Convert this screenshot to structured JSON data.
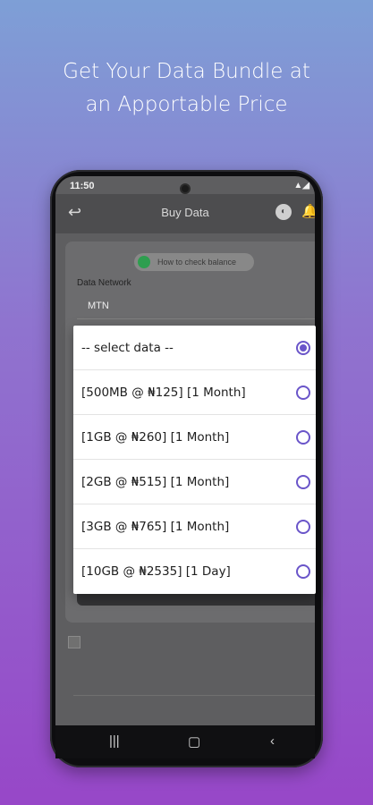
{
  "headline": {
    "line1": "Get Your Data Bundle at",
    "line2": "an Apportable Price"
  },
  "status_bar": {
    "time": "11:50"
  },
  "app_bar": {
    "title": "Buy Data",
    "back_icon": "back-arrow-icon",
    "wallet_icon": "wallet-icon",
    "bell_icon": "bell-icon"
  },
  "balance_chip": {
    "label": "How to check balance"
  },
  "network": {
    "label": "Data Network",
    "value": "MTN"
  },
  "data_options": [
    {
      "label": "-- select data --",
      "selected": true
    },
    {
      "label": "[500MB @ ₦125] [1 Month]",
      "selected": false
    },
    {
      "label": "[1GB @ ₦260] [1 Month]",
      "selected": false
    },
    {
      "label": "[2GB @ ₦515] [1 Month]",
      "selected": false
    },
    {
      "label": "[3GB @ ₦765] [1 Month]",
      "selected": false
    },
    {
      "label": "[10GB @ ₦2535] [1 Day]",
      "selected": false
    }
  ],
  "colors": {
    "accent": "#6a55c9",
    "bg_top": "#7e9fd6",
    "bg_bottom": "#9747c8"
  }
}
